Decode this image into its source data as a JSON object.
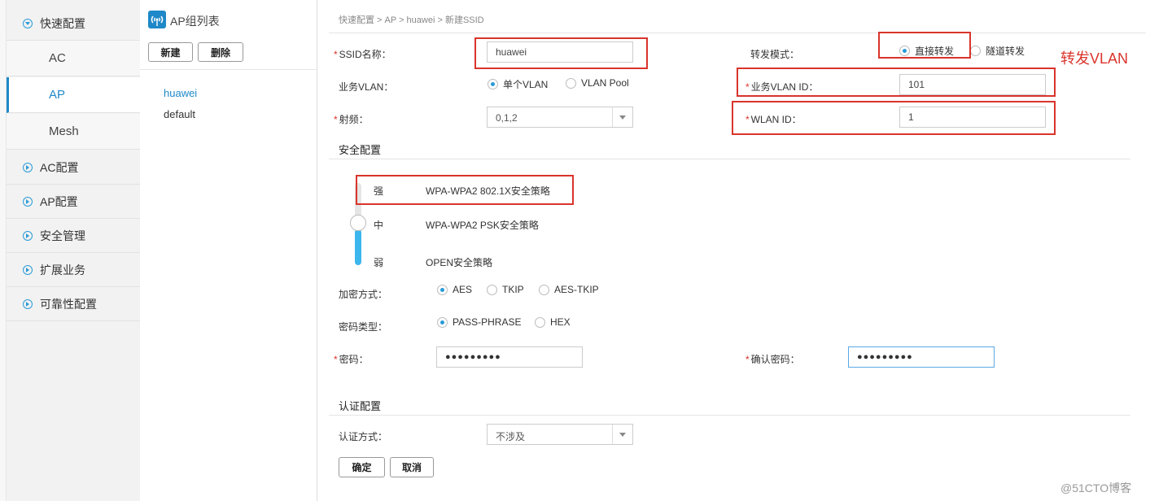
{
  "sidebar": {
    "items": [
      {
        "label": "快速配置",
        "expanded": true
      },
      {
        "label": "AC配置"
      },
      {
        "label": "AP配置"
      },
      {
        "label": "安全管理"
      },
      {
        "label": "扩展业务"
      },
      {
        "label": "可靠性配置"
      }
    ],
    "sub_items": [
      {
        "label": "AC"
      },
      {
        "label": "AP",
        "active": true
      },
      {
        "label": "Mesh"
      }
    ]
  },
  "ap_group": {
    "title": "AP组列表",
    "new_label": "新建",
    "delete_label": "删除",
    "groups": [
      "huawei",
      "default"
    ],
    "selected": "huawei"
  },
  "breadcrumb": "快速配置 > AP > huawei > 新建SSID",
  "form": {
    "ssid_label": "SSID名称：",
    "ssid_value": "huawei",
    "forward_mode_label": "转发模式：",
    "forward_direct": "直接转发",
    "forward_tunnel": "隧道转发",
    "annotation": "转发VLAN",
    "service_vlan_label": "业务VLAN：",
    "vlan_single": "单个VLAN",
    "vlan_pool": "VLAN Pool",
    "service_vlan_id_label": "业务VLAN ID：",
    "service_vlan_id_value": "101",
    "radio_label": "射频：",
    "radio_value": "0,1,2",
    "wlan_id_label": "WLAN ID：",
    "wlan_id_value": "1",
    "security_section": "安全配置",
    "security_levels": [
      {
        "level": "强",
        "policy": "WPA-WPA2 802.1X安全策略"
      },
      {
        "level": "中",
        "policy": "WPA-WPA2 PSK安全策略"
      },
      {
        "level": "弱",
        "policy": "OPEN安全策略"
      }
    ],
    "encryption_label": "加密方式：",
    "encryption_options": [
      "AES",
      "TKIP",
      "AES-TKIP"
    ],
    "key_type_label": "密码类型：",
    "key_type_options": [
      "PASS-PHRASE",
      "HEX"
    ],
    "password_label": "密码：",
    "password_value": "●●●●●●●●●",
    "confirm_password_label": "确认密码：",
    "confirm_password_value": "●●●●●●●●●",
    "auth_section": "认证配置",
    "auth_mode_label": "认证方式：",
    "auth_mode_value": "不涉及",
    "ok_label": "确定",
    "cancel_label": "取消"
  },
  "watermark": "@51CTO博客",
  "colors": {
    "accent": "#2a9bd8",
    "highlight": "#d9342b"
  }
}
